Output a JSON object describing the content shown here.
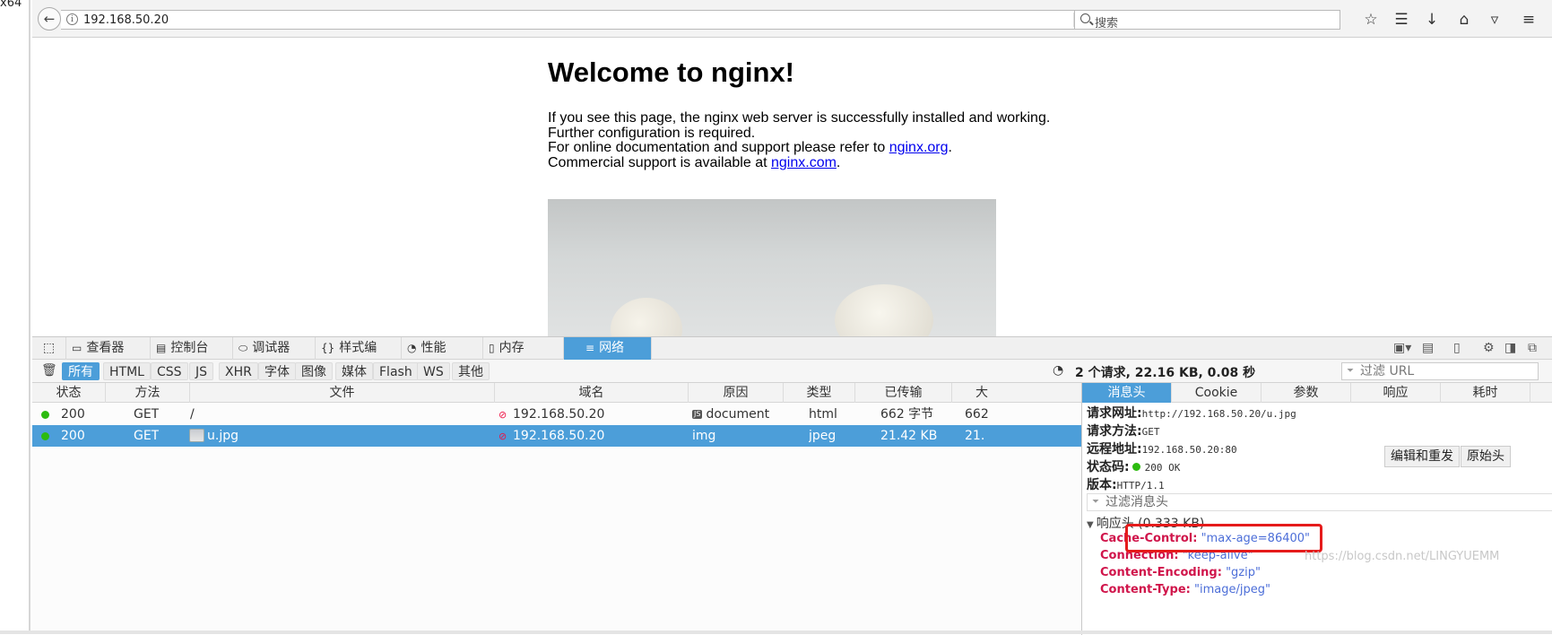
{
  "desktop": {
    "label": "x64"
  },
  "browser": {
    "url": "192.168.50.20",
    "search_placeholder": "搜索"
  },
  "page": {
    "heading": "Welcome to nginx!",
    "p1_line1": "If you see this page, the nginx web server is successfully installed and working.",
    "p1_line2": "Further configuration is required.",
    "p2_line1_prefix": "For online documentation and support please refer to ",
    "p2_link1": "nginx.org",
    "p2_line1_suffix": ".",
    "p2_line2_prefix": "Commercial support is available at ",
    "p2_link2": "nginx.com",
    "p2_line2_suffix": "."
  },
  "devtools": {
    "tabs": [
      "查看器",
      "控制台",
      "调试器",
      "样式编辑...",
      "性能",
      "内存",
      "网络"
    ],
    "active_tab": "网络",
    "filters": [
      "所有",
      "HTML",
      "CSS",
      "JS",
      "XHR",
      "字体",
      "图像",
      "媒体",
      "Flash",
      "WS",
      "其他"
    ],
    "active_filter": "所有",
    "summary": "2 个请求, 22.16 KB, 0.08 秒",
    "filter_url_placeholder": "过滤 URL",
    "columns": [
      "状态",
      "方法",
      "文件",
      "域名",
      "原因",
      "类型",
      "已传输",
      "大"
    ],
    "requests": [
      {
        "status": "200",
        "method": "GET",
        "file": "/",
        "domain": "192.168.50.20",
        "cause": "document",
        "type": "html",
        "transferred": "662 字节",
        "size": "662"
      },
      {
        "status": "200",
        "method": "GET",
        "file": "u.jpg",
        "domain": "192.168.50.20",
        "cause": "img",
        "type": "jpeg",
        "transferred": "21.42 KB",
        "size": "21."
      }
    ],
    "details": {
      "tabs": [
        "消息头",
        "Cookie",
        "参数",
        "响应",
        "耗时"
      ],
      "active_tab": "消息头",
      "request_url_label": "请求网址:",
      "request_url": "http://192.168.50.20/u.jpg",
      "request_method_label": "请求方法:",
      "request_method": "GET",
      "remote_address_label": "远程地址:",
      "remote_address": "192.168.50.20:80",
      "status_code_label": "状态码:",
      "status_code": "200 OK",
      "version_label": "版本:",
      "version": "HTTP/1.1",
      "edit_resend": "编辑和重发",
      "raw_headers": "原始头",
      "filter_headers_placeholder": "过滤消息头",
      "response_headers_label": "响应头 (0.333 KB)",
      "headers": [
        {
          "name": "Cache-Control:",
          "value": "\"max-age=86400\""
        },
        {
          "name": "Connection:",
          "value": "\"keep-alive\""
        },
        {
          "name": "Content-Encoding:",
          "value": "\"gzip\""
        },
        {
          "name": "Content-Type:",
          "value": "\"image/jpeg\""
        }
      ]
    },
    "watermark": "https://blog.csdn.net/LINGYUEMM"
  },
  "colors": {
    "accent": "#4c9ed9",
    "highlight": "#e51b1b",
    "header_key": "#d0154b",
    "header_value": "#4c6ed8",
    "status_ok": "#2cbb0f"
  }
}
